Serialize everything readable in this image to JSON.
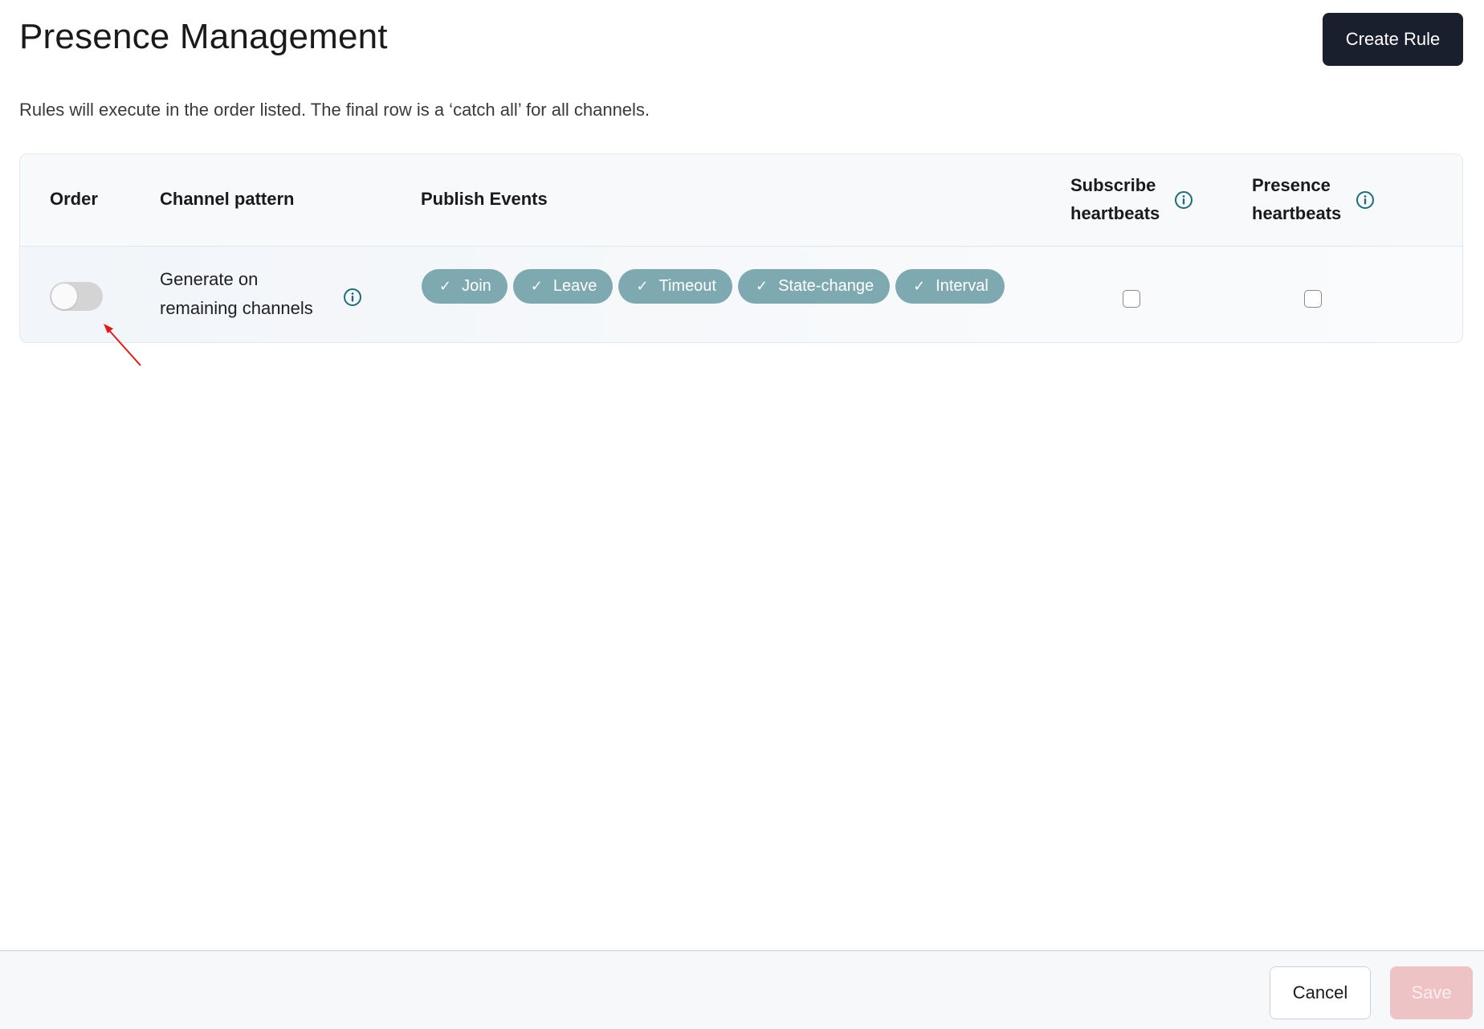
{
  "header": {
    "title": "Presence Management",
    "create_button": "Create Rule",
    "subtitle": "Rules will execute in the order listed. The final row is a ‘catch all’ for all channels."
  },
  "table": {
    "columns": {
      "order": "Order",
      "channel_pattern": "Channel pattern",
      "publish_events": "Publish Events",
      "subscribe_heartbeats_line1": "Subscribe",
      "subscribe_heartbeats_line2": "heartbeats",
      "presence_heartbeats_line1": "Presence",
      "presence_heartbeats_line2": "heartbeats"
    },
    "rows": [
      {
        "order_toggle_on": false,
        "channel_line1": "Generate on",
        "channel_line2": "remaining channels",
        "events": [
          {
            "label": "Join",
            "checked": true
          },
          {
            "label": "Leave",
            "checked": true
          },
          {
            "label": "Timeout",
            "checked": true
          },
          {
            "label": "State-change",
            "checked": true
          },
          {
            "label": "Interval",
            "checked": true
          }
        ],
        "subscribe_heartbeats": false,
        "presence_heartbeats": false
      }
    ],
    "check_glyph": "✓"
  },
  "footer": {
    "cancel": "Cancel",
    "save": "Save"
  },
  "colors": {
    "primary_button": "#1a1f2e",
    "chip": "#7fa9b1",
    "info_icon": "#1d6e78",
    "save_disabled": "#eec3c6",
    "annotation_arrow": "#e01b1b"
  }
}
